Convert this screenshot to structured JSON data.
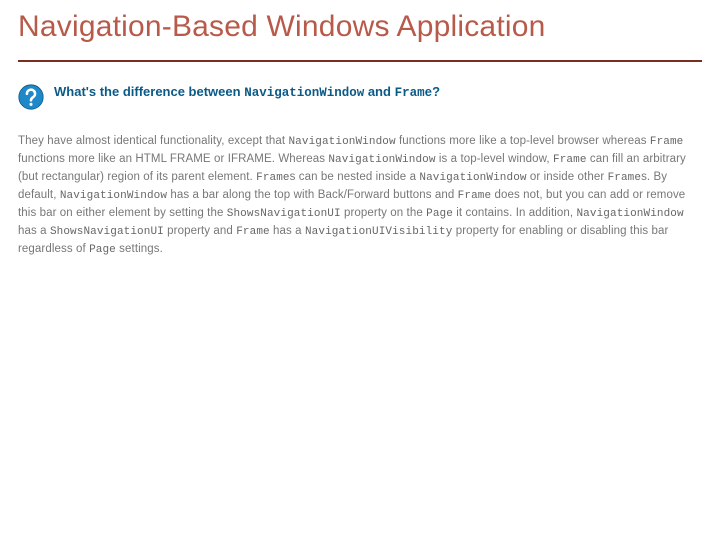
{
  "slide": {
    "title": "Navigation-Based Windows Application"
  },
  "faq": {
    "icon_name": "question-icon",
    "question_prefix": "What's the difference between ",
    "question_code1": "NavigationWindow",
    "question_mid": " and ",
    "question_code2": "Frame",
    "question_suffix": "?",
    "answer": {
      "p1a": "They have almost identical functionality, except that ",
      "c1": "NavigationWindow",
      "p1b": " functions more like a top-level browser whereas ",
      "c2": "Frame",
      "p1c": " functions more like an HTML FRAME or IFRAME. Whereas ",
      "c3": "NavigationWindow",
      "p1d": " is a top-level window, ",
      "c4": "Frame",
      "p1e": " can fill an arbitrary (but rectangular) region of its parent element. ",
      "c5": "Frame",
      "p1f": "s can be nested inside a ",
      "c6": "NavigationWindow",
      "p1g": " or inside other ",
      "c7": "Frame",
      "p1h": "s. By default, ",
      "c8": "NavigationWindow",
      "p1i": " has a bar along the top with Back/Forward buttons and ",
      "c9": "Frame",
      "p1j": " does not, but you can add or remove this bar on either element by setting the ",
      "c10": "ShowsNavigationUI",
      "p1k": " property on the ",
      "c11": "Page",
      "p1l": " it contains. In addition, ",
      "c12": "NavigationWindow",
      "p1m": " has a ",
      "c13": "ShowsNavigationUI",
      "p1n": " property and ",
      "c14": "Frame",
      "p1o": " has a ",
      "c15": "NavigationUIVisibility",
      "p1p": " property for enabling or disabling this bar regardless of ",
      "c16": "Page",
      "p1q": " settings."
    }
  }
}
